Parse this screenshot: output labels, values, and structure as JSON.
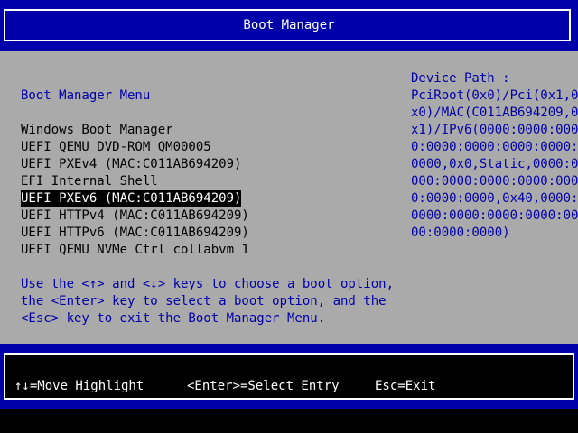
{
  "header": {
    "title": "Boot Manager"
  },
  "menu": {
    "heading": "Boot Manager Menu",
    "items": [
      {
        "label": "Windows Boot Manager",
        "selected": false
      },
      {
        "label": "UEFI QEMU DVD-ROM QM00005",
        "selected": false
      },
      {
        "label": "UEFI PXEv4 (MAC:C011AB694209)",
        "selected": false
      },
      {
        "label": "EFI Internal Shell",
        "selected": false
      },
      {
        "label": "UEFI PXEv6 (MAC:C011AB694209)",
        "selected": true
      },
      {
        "label": "UEFI HTTPv4 (MAC:C011AB694209)",
        "selected": false
      },
      {
        "label": "UEFI HTTPv6 (MAC:C011AB694209)",
        "selected": false
      },
      {
        "label": "UEFI QEMU NVMe Ctrl collabvm 1",
        "selected": false
      }
    ]
  },
  "help": {
    "lines": [
      "Use the <↑> and <↓> keys to choose a boot option,",
      "the <Enter> key to select a boot option, and the",
      "<Esc> key to exit the Boot Manager Menu."
    ]
  },
  "device_path": {
    "heading": "Device Path :",
    "lines": [
      "PciRoot(0x0)/Pci(0x1,0",
      "x0)/MAC(C011AB694209,0",
      "x1)/IPv6(0000:0000:000",
      "0:0000:0000:0000:0000:",
      "0000,0x0,Static,0000:0",
      "000:0000:0000:0000:000",
      "0:0000:0000,0x40,0000:",
      "0000:0000:0000:0000:00",
      "00:0000:0000)"
    ]
  },
  "footer": {
    "move": "↑↓=Move Highlight",
    "select": "<Enter>=Select Entry",
    "exit": "Esc=Exit"
  },
  "colors": {
    "frame_blue": "#0000aa",
    "body_gray": "#aaaaaa",
    "highlight_bg": "#000000",
    "text_white": "#ffffff"
  }
}
